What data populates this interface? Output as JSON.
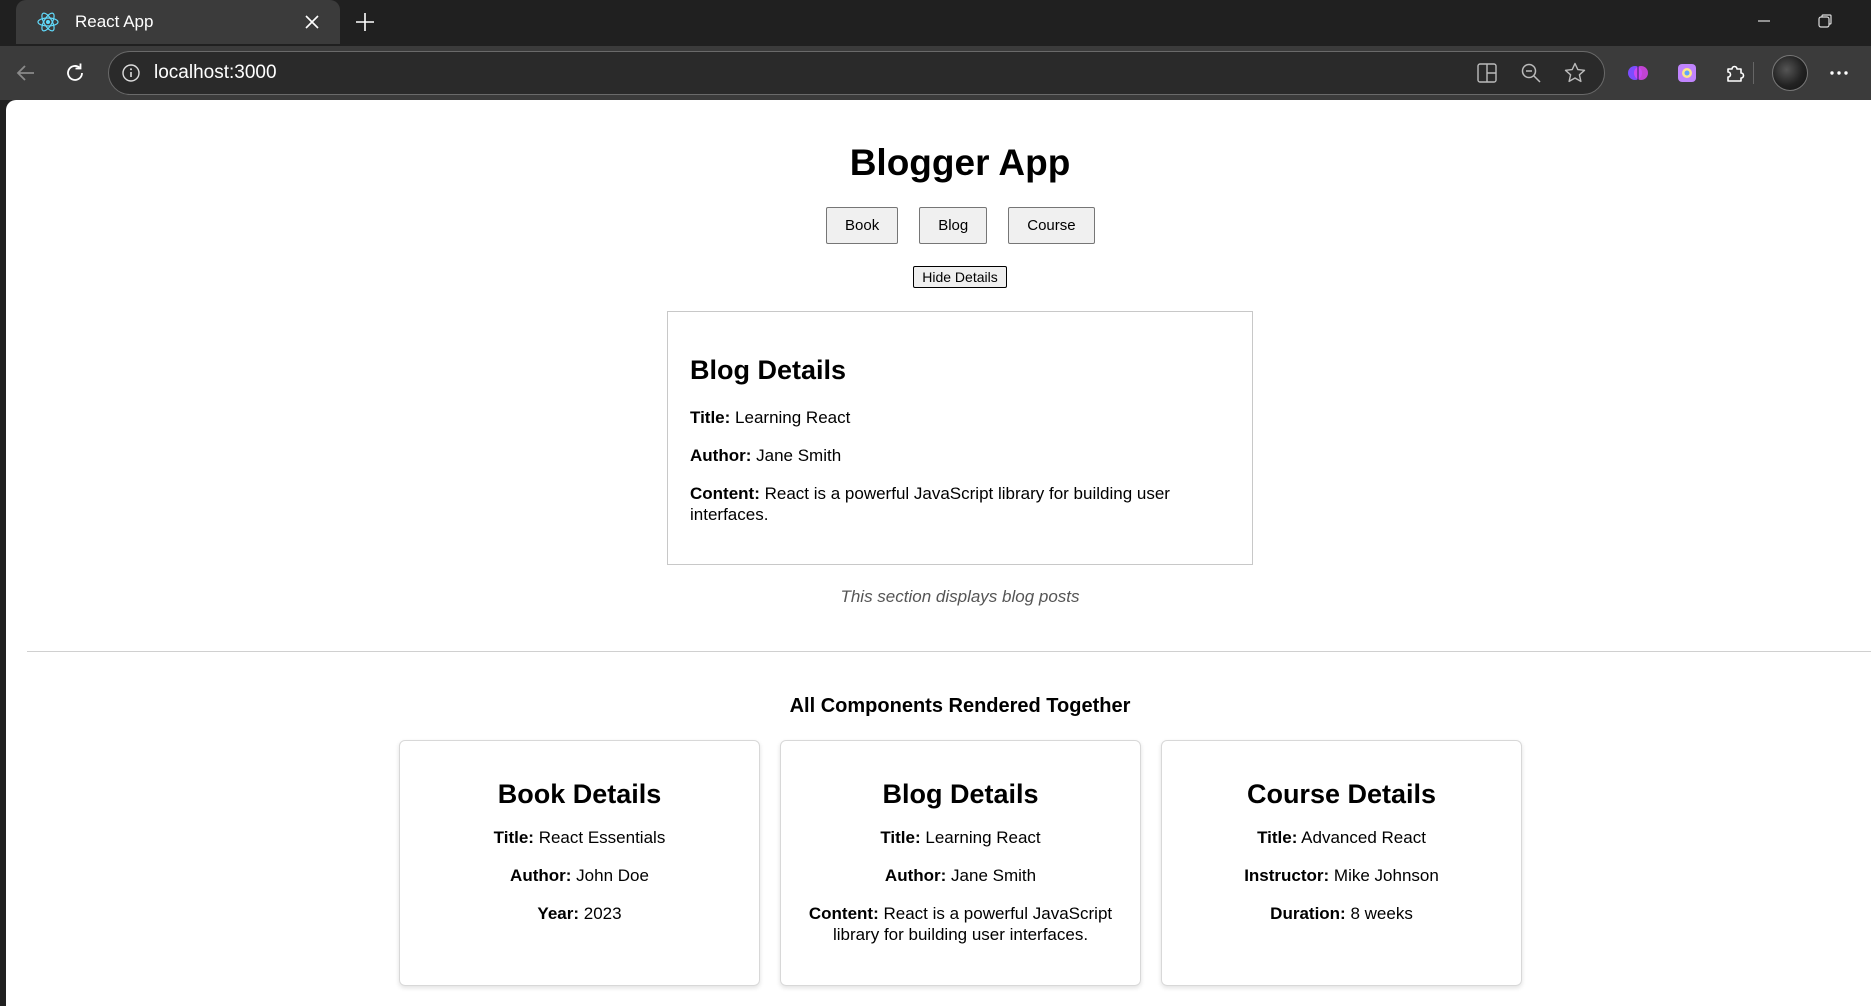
{
  "browser": {
    "tab_title": "React App",
    "url": "localhost:3000"
  },
  "app": {
    "title": "Blogger App",
    "nav": [
      {
        "label": "Book"
      },
      {
        "label": "Blog"
      },
      {
        "label": "Course"
      }
    ],
    "toggle_label": "Hide Details",
    "details": {
      "heading": "Blog Details",
      "title_label": "Title:",
      "title_value": "Learning React",
      "author_label": "Author:",
      "author_value": "Jane Smith",
      "content_label": "Content:",
      "content_value": "React is a powerful JavaScript library for building user interfaces."
    },
    "caption": "This section displays blog posts",
    "all_heading": "All Components Rendered Together",
    "cards": {
      "book": {
        "heading": "Book Details",
        "title_label": "Title:",
        "title_value": "React Essentials",
        "author_label": "Author:",
        "author_value": "John Doe",
        "year_label": "Year:",
        "year_value": "2023"
      },
      "blog": {
        "heading": "Blog Details",
        "title_label": "Title:",
        "title_value": "Learning React",
        "author_label": "Author:",
        "author_value": "Jane Smith",
        "content_label": "Content:",
        "content_value": "React is a powerful JavaScript library for building user interfaces."
      },
      "course": {
        "heading": "Course Details",
        "title_label": "Title:",
        "title_value": "Advanced React",
        "instructor_label": "Instructor:",
        "instructor_value": "Mike Johnson",
        "duration_label": "Duration:",
        "duration_value": "8 weeks"
      }
    }
  },
  "icons": {
    "favicon": "react-logo-icon",
    "tab_close": "close-icon",
    "new_tab": "plus-icon",
    "back": "back-arrow-icon",
    "reload": "reload-icon",
    "site_info": "info-icon",
    "split_screen": "split-screen-icon",
    "zoom": "zoom-out-icon",
    "favorite": "star-icon",
    "extension_1": "brain-extension-icon",
    "extension_2": "copilot-extension-icon",
    "extensions": "puzzle-icon",
    "profile": "avatar",
    "menu": "more-icon",
    "minimize": "minimize-icon",
    "maximize": "restore-icon"
  },
  "colors": {
    "chrome_dark": "#202020",
    "toolbar": "#3b3b3b",
    "page_bg": "#ffffff",
    "react_blue": "#61dafb",
    "caption_text": "#555555"
  }
}
